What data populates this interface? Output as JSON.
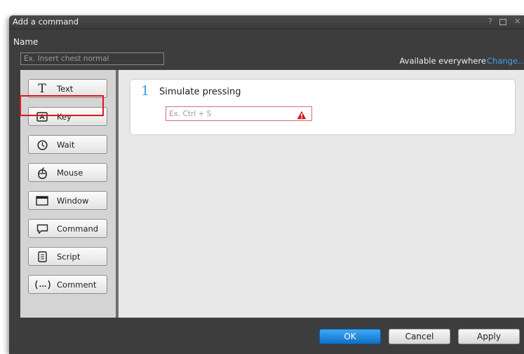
{
  "window": {
    "title": "Add a command",
    "help_label": "?",
    "close_label": "✕"
  },
  "name": {
    "label": "Name",
    "placeholder": "Ex. Insert chest normal",
    "value": ""
  },
  "availability": {
    "text": "Available everywhere",
    "change_label": "Change..."
  },
  "command_buttons": [
    {
      "label": "Text",
      "icon": "text-icon"
    },
    {
      "label": "Key",
      "icon": "key-icon"
    },
    {
      "label": "Wait",
      "icon": "clock-icon"
    },
    {
      "label": "Mouse",
      "icon": "mouse-icon"
    },
    {
      "label": "Window",
      "icon": "window-icon"
    },
    {
      "label": "Command",
      "icon": "speech-bubble-icon"
    },
    {
      "label": "Script",
      "icon": "script-icon"
    },
    {
      "label": "Comment",
      "icon": "comment-icon"
    }
  ],
  "highlighted_button": "Key",
  "step": {
    "number": "1",
    "title": "Simulate pressing",
    "key_placeholder": "Ex. Ctrl + S",
    "key_value": "",
    "warning_icon": "warning-icon"
  },
  "footer": {
    "ok_label": "OK",
    "cancel_label": "Cancel",
    "apply_label": "Apply"
  },
  "colors": {
    "accent": "#3b9be6",
    "link": "#3fa0ee",
    "highlight": "#e0141a",
    "warning": "#cc1c1c",
    "dialog_bg": "#3d3d3d"
  }
}
